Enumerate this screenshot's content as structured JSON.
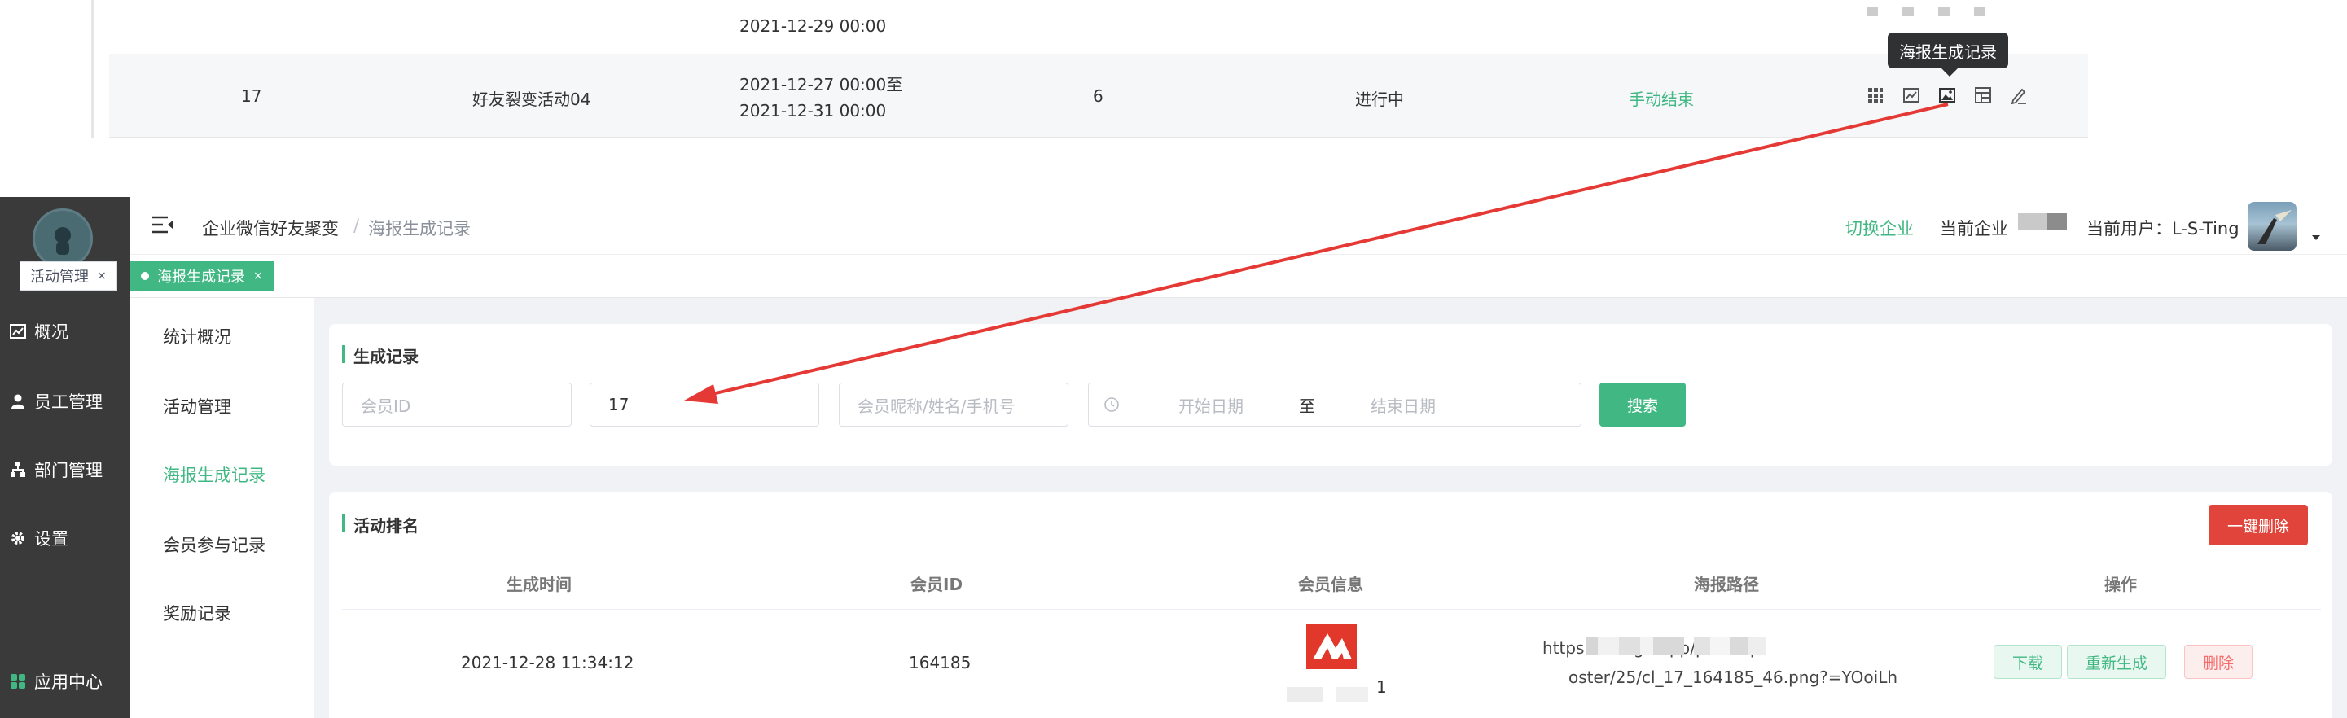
{
  "old_table": {
    "prev_row_time": "2021-12-29 00:00",
    "row": {
      "id": "17",
      "name": "好友裂变活动04",
      "time_line1": "2021-12-27 00:00至",
      "time_line2": "2021-12-31 00:00",
      "count": "6",
      "status": "进行中",
      "action": "手动结束"
    },
    "tooltip": "海报生成记录"
  },
  "sidebar": {
    "items": [
      {
        "label": "概况",
        "icon": "chart-icon"
      },
      {
        "label": "员工管理",
        "icon": "user-icon"
      },
      {
        "label": "部门管理",
        "icon": "org-icon"
      },
      {
        "label": "设置",
        "icon": "gear-icon"
      }
    ],
    "app_center": "应用中心"
  },
  "header": {
    "breadcrumb_root": "企业微信好友聚变",
    "breadcrumb_sep": "/",
    "breadcrumb_current": "海报生成记录",
    "switch_company": "切换企业",
    "current_company_label": "当前企业",
    "current_user_label": "当前用户：L-S-Ting"
  },
  "tabs": [
    {
      "label": "活动管理"
    },
    {
      "label": "海报生成记录"
    }
  ],
  "submenu": {
    "items": [
      "统计概况",
      "活动管理",
      "海报生成记录",
      "会员参与记录",
      "奖励记录"
    ]
  },
  "filter": {
    "title": "生成记录",
    "member_id_placeholder": "会员ID",
    "activity_id_value": "17",
    "member_search_placeholder": "会员昵称/姓名/手机号",
    "start_date_placeholder": "开始日期",
    "date_sep": "至",
    "end_date_placeholder": "结束日期",
    "search_label": "搜索"
  },
  "ranking": {
    "title": "活动排名",
    "delete_all_label": "一键删除",
    "columns": [
      "生成时间",
      "会员ID",
      "会员信息",
      "海报路径",
      "操作"
    ],
    "rows": [
      {
        "time": "2021-12-28 11:34:12",
        "member_id": "164185",
        "member_suffix": "1",
        "path_line1": "https:/              torage/app/public/p",
        "path_line2": "oster/25/cl_17_164185_46.png?=YOoiLh",
        "download": "下载",
        "regenerate": "重新生成",
        "delete": "删除"
      }
    ]
  },
  "colors": {
    "accent": "#41b883",
    "danger": "#e0443b",
    "sidebar_bg": "#3a3a3a",
    "annotation_arrow": "#e53935"
  }
}
